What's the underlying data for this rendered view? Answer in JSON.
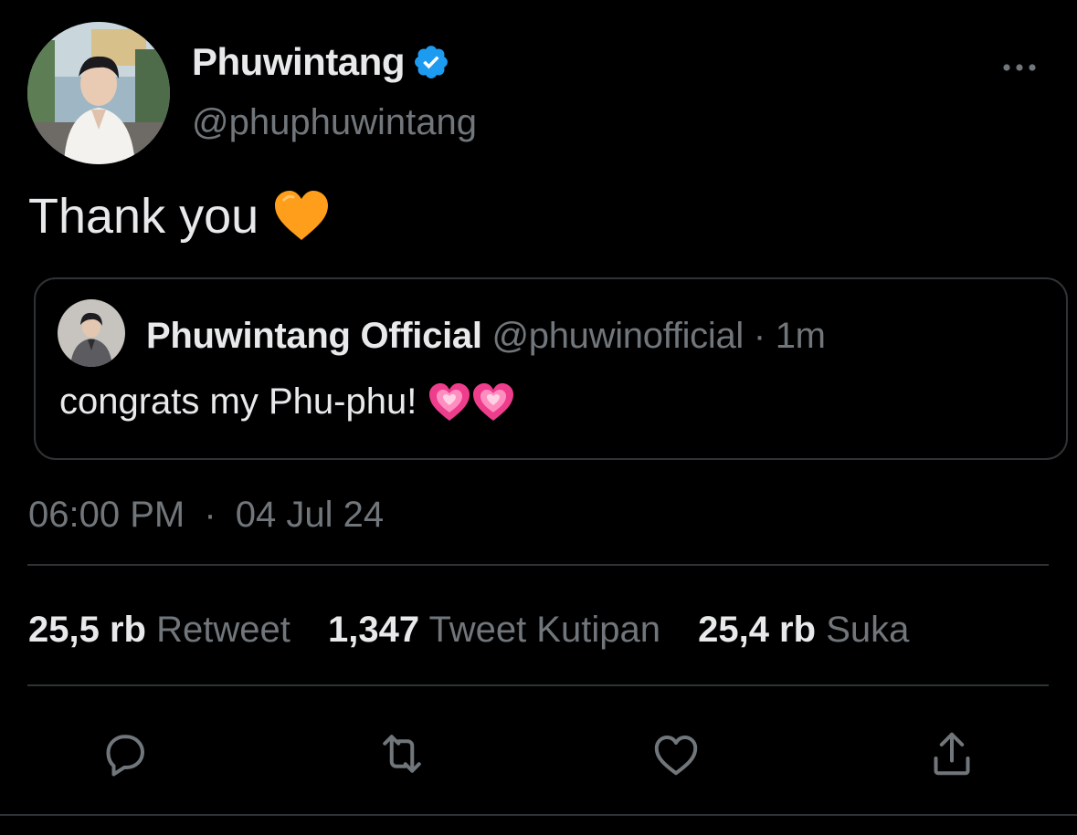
{
  "tweet": {
    "display_name": "Phuwintang",
    "handle": "@phuphuwintang",
    "text": "Thank you",
    "emoji": "orange-heart",
    "timestamp_time": "06:00 PM",
    "timestamp_sep": "·",
    "timestamp_date": "04 Jul 24"
  },
  "quote": {
    "display_name": "Phuwintang Official",
    "handle": "@phuwinofficial",
    "sep": "·",
    "time": "1m",
    "text": "congrats my Phu-phu!",
    "emoji": "growing-pink-heart"
  },
  "stats": {
    "retweets_count": "25,5 rb",
    "retweets_label": "Retweet",
    "quotes_count": "1,347",
    "quotes_label": "Tweet Kutipan",
    "likes_count": "25,4 rb",
    "likes_label": "Suka"
  },
  "actions": [
    "reply-icon",
    "retweet-icon",
    "like-icon",
    "share-icon"
  ],
  "colors": {
    "background": "#000000",
    "text_primary": "#e7e9ea",
    "text_secondary": "#71767b",
    "border": "#2f3336",
    "verified": "#1d9bf0"
  }
}
